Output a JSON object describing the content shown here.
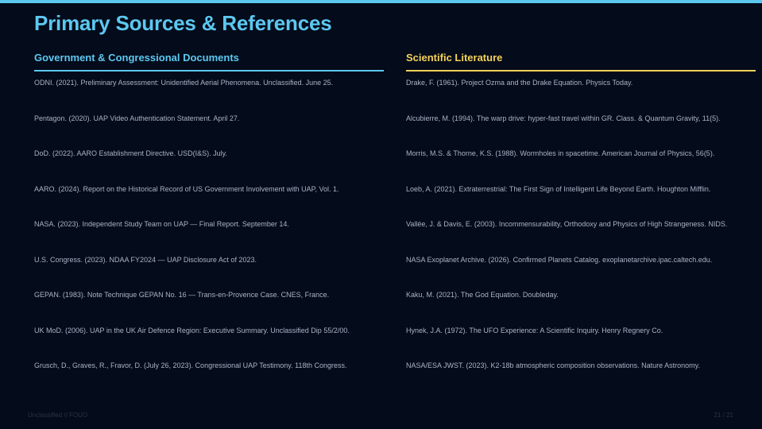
{
  "slide": {
    "title": "Primary Sources & References",
    "accent_color": "#5cc8f0",
    "secondary_color": "#f5d35a"
  },
  "left_column": {
    "heading": "Government & Congressional Documents",
    "references": [
      "ODNI. (2021). Preliminary Assessment: Unidentified Aerial Phenomena. Unclassified. June 25.",
      "Pentagon. (2020). UAP Video Authentication Statement. April 27.",
      "DoD. (2022). AARO Establishment Directive. USD(I&S). July.",
      "AARO. (2024). Report on the Historical Record of US Government Involvement with UAP, Vol. 1.",
      "NASA. (2023). Independent Study Team on UAP — Final Report. September 14.",
      "U.S. Congress. (2023). NDAA FY2024 — UAP Disclosure Act of 2023.",
      "GEPAN. (1983). Note Technique GEPAN No. 16 — Trans-en-Provence Case. CNES, France.",
      "UK MoD. (2006). UAP in the UK Air Defence Region: Executive Summary. Unclassified Dip 55/2/00.",
      "Grusch, D., Graves, R., Fravor, D. (July 26, 2023). Congressional UAP Testimony. 118th Congress."
    ]
  },
  "right_column": {
    "heading": "Scientific Literature",
    "references": [
      "Drake, F. (1961). Project Ozma and the Drake Equation. Physics Today.",
      "Alcubierre, M. (1994). The warp drive: hyper-fast travel within GR. Class. & Quantum Gravity, 11(5).",
      "Morris, M.S. & Thorne, K.S. (1988). Wormholes in spacetime. American Journal of Physics, 56(5).",
      "Loeb, A. (2021). Extraterrestrial: The First Sign of Intelligent Life Beyond Earth. Houghton Mifflin.",
      "Vallée, J. & Davis, E. (2003). Incommensurability, Orthodoxy and Physics of High Strangeness. NIDS.",
      "NASA Exoplanet Archive. (2026). Confirmed Planets Catalog. exoplanetarchive.ipac.caltech.edu.",
      "Kaku, M. (2021). The God Equation. Doubleday.",
      "Hynek, J.A. (1972). The UFO Experience: A Scientific Inquiry. Henry Regnery Co.",
      "NASA/ESA JWST. (2023). K2-18b atmospheric composition observations. Nature Astronomy."
    ]
  },
  "footer": {
    "classification": "Unclassified // FOUO",
    "page_number": "21 / 21"
  }
}
